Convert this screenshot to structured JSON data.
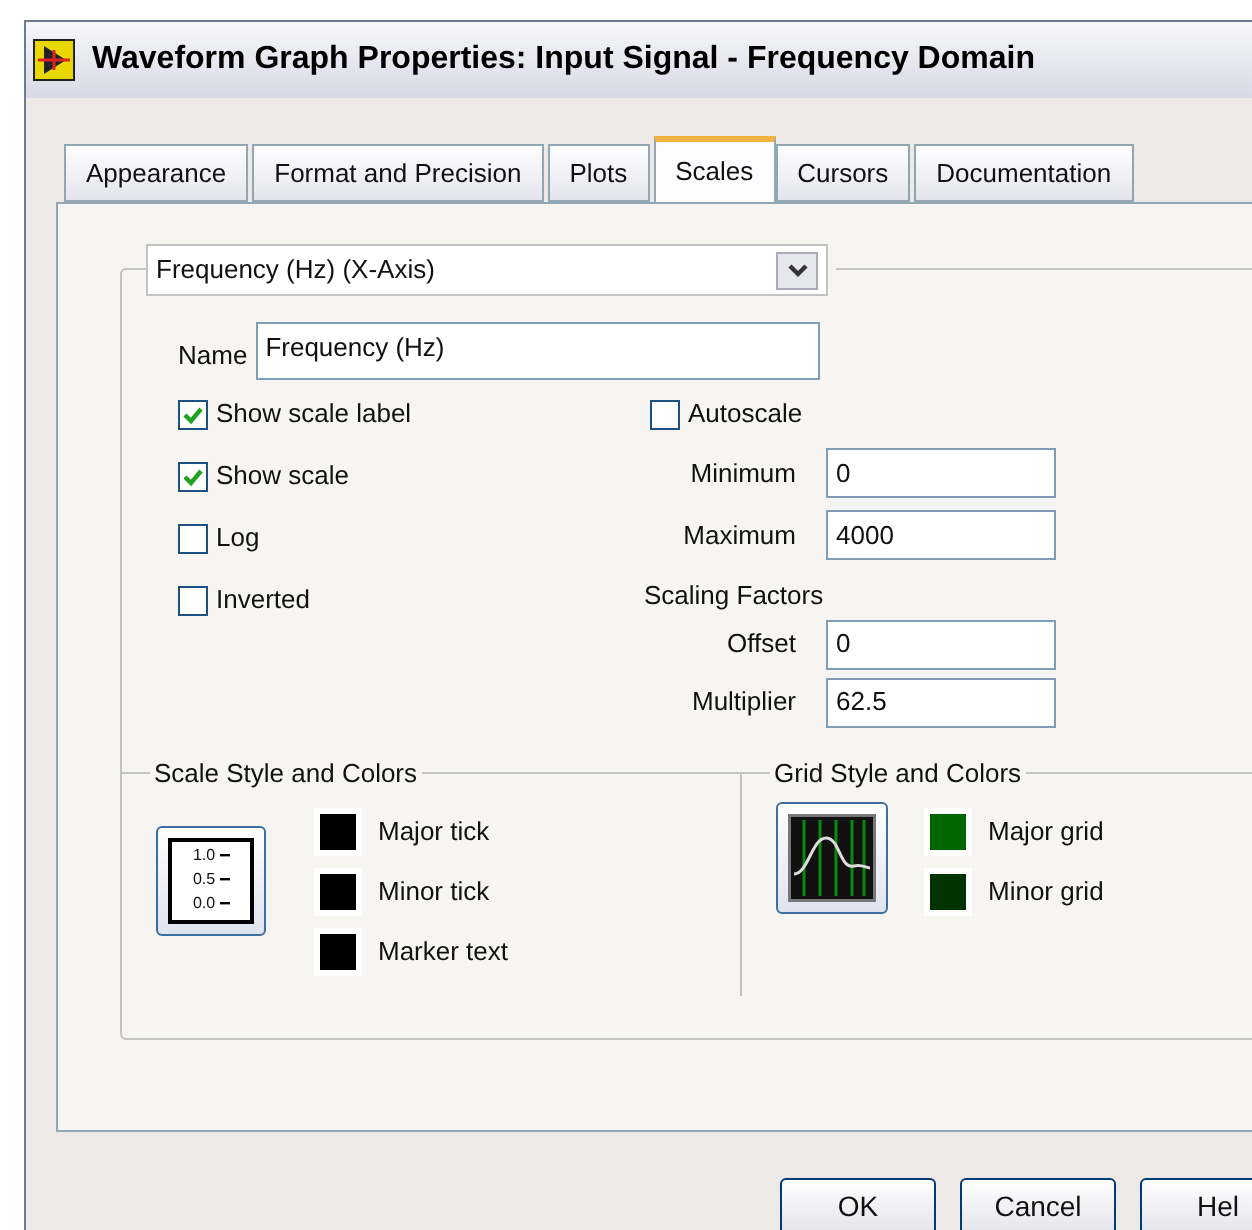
{
  "window": {
    "title": "Waveform Graph Properties:  Input Signal - Frequency Domain"
  },
  "tabs": [
    {
      "label": "Appearance",
      "selected": false
    },
    {
      "label": "Format and Precision",
      "selected": false
    },
    {
      "label": "Plots",
      "selected": false
    },
    {
      "label": "Scales",
      "selected": true
    },
    {
      "label": "Cursors",
      "selected": false
    },
    {
      "label": "Documentation",
      "selected": false
    }
  ],
  "axis_select": {
    "value": "Frequency (Hz) (X-Axis)"
  },
  "name_field": {
    "label": "Name",
    "value": "Frequency (Hz)"
  },
  "options": [
    {
      "label": "Show scale label",
      "checked": true
    },
    {
      "label": "Show scale",
      "checked": true
    },
    {
      "label": "Log",
      "checked": false
    },
    {
      "label": "Inverted",
      "checked": false
    }
  ],
  "autoscale": {
    "label": "Autoscale",
    "checked": false
  },
  "range": [
    {
      "label": "Minimum",
      "value": "0"
    },
    {
      "label": "Maximum",
      "value": "4000"
    }
  ],
  "scaling_factors": {
    "title": "Scaling Factors",
    "fields": [
      {
        "label": "Offset",
        "value": "0"
      },
      {
        "label": "Multiplier",
        "value": "62.5"
      }
    ]
  },
  "scale_style": {
    "title": "Scale Style and Colors",
    "icon_labels": [
      "1.0",
      "0.5",
      "0.0"
    ],
    "colors": [
      {
        "label": "Major tick",
        "color": "#000000"
      },
      {
        "label": "Minor tick",
        "color": "#000000"
      },
      {
        "label": "Marker text",
        "color": "#000000"
      }
    ]
  },
  "grid_style": {
    "title": "Grid Style and Colors",
    "colors": [
      {
        "label": "Major grid",
        "color": "#006600"
      },
      {
        "label": "Minor grid",
        "color": "#003300"
      }
    ]
  },
  "buttons": [
    "OK",
    "Cancel",
    "Hel"
  ]
}
